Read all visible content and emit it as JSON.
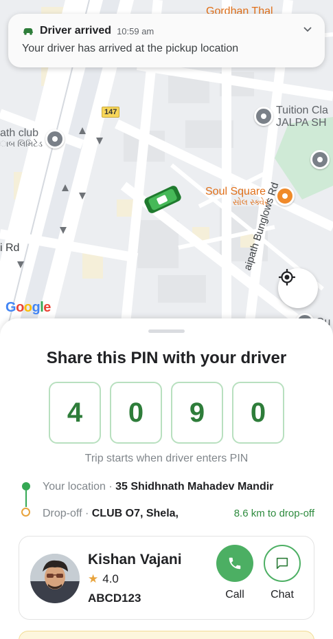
{
  "map": {
    "labels": {
      "gordhan": "Gordhan Thal",
      "tuition_1": "Tuition Cla",
      "tuition_2": "JALPA SH",
      "club_1": "ath club",
      "club_2": "ાબ લિમિટેડ",
      "soul_1": "Soul Square",
      "soul_2": "સોલ સ્ક્વેર",
      "road_left": "i Rd",
      "bunglows": "aipath Bunglows Rd",
      "gu": "Gu",
      "road_number": "147"
    },
    "google": [
      "G",
      "o",
      "o",
      "g",
      "l",
      "e"
    ],
    "google_colors": [
      "#4285F4",
      "#EA4335",
      "#FBBC05",
      "#4285F4",
      "#34A853",
      "#EA4335"
    ],
    "locate_icon": "my-location-icon"
  },
  "notification": {
    "title": "Driver arrived",
    "time": "10:59 am",
    "body": "Your driver has arrived at the pickup location",
    "icon": "car-icon"
  },
  "pin": {
    "title": "Share this PIN with your driver",
    "digits": [
      "4",
      "0",
      "9",
      "0"
    ],
    "hint": "Trip starts when driver enters PIN"
  },
  "route": {
    "pickup_label": "Your location",
    "pickup_value": "35 Shidhnath Mahadev Mandir",
    "dropoff_label": "Drop-off",
    "dropoff_value": "CLUB O7, Shela,",
    "distance": "8.6 km to drop-off"
  },
  "driver": {
    "name": "Kishan Vajani",
    "rating": "4.0",
    "plate": "ABCD123",
    "call_label": "Call",
    "chat_label": "Chat"
  },
  "colors": {
    "accent_green": "#4caf63",
    "pin_text": "#2e7d3a",
    "pickup_dot": "#34a853",
    "dropoff_dot": "#e8a33c"
  }
}
